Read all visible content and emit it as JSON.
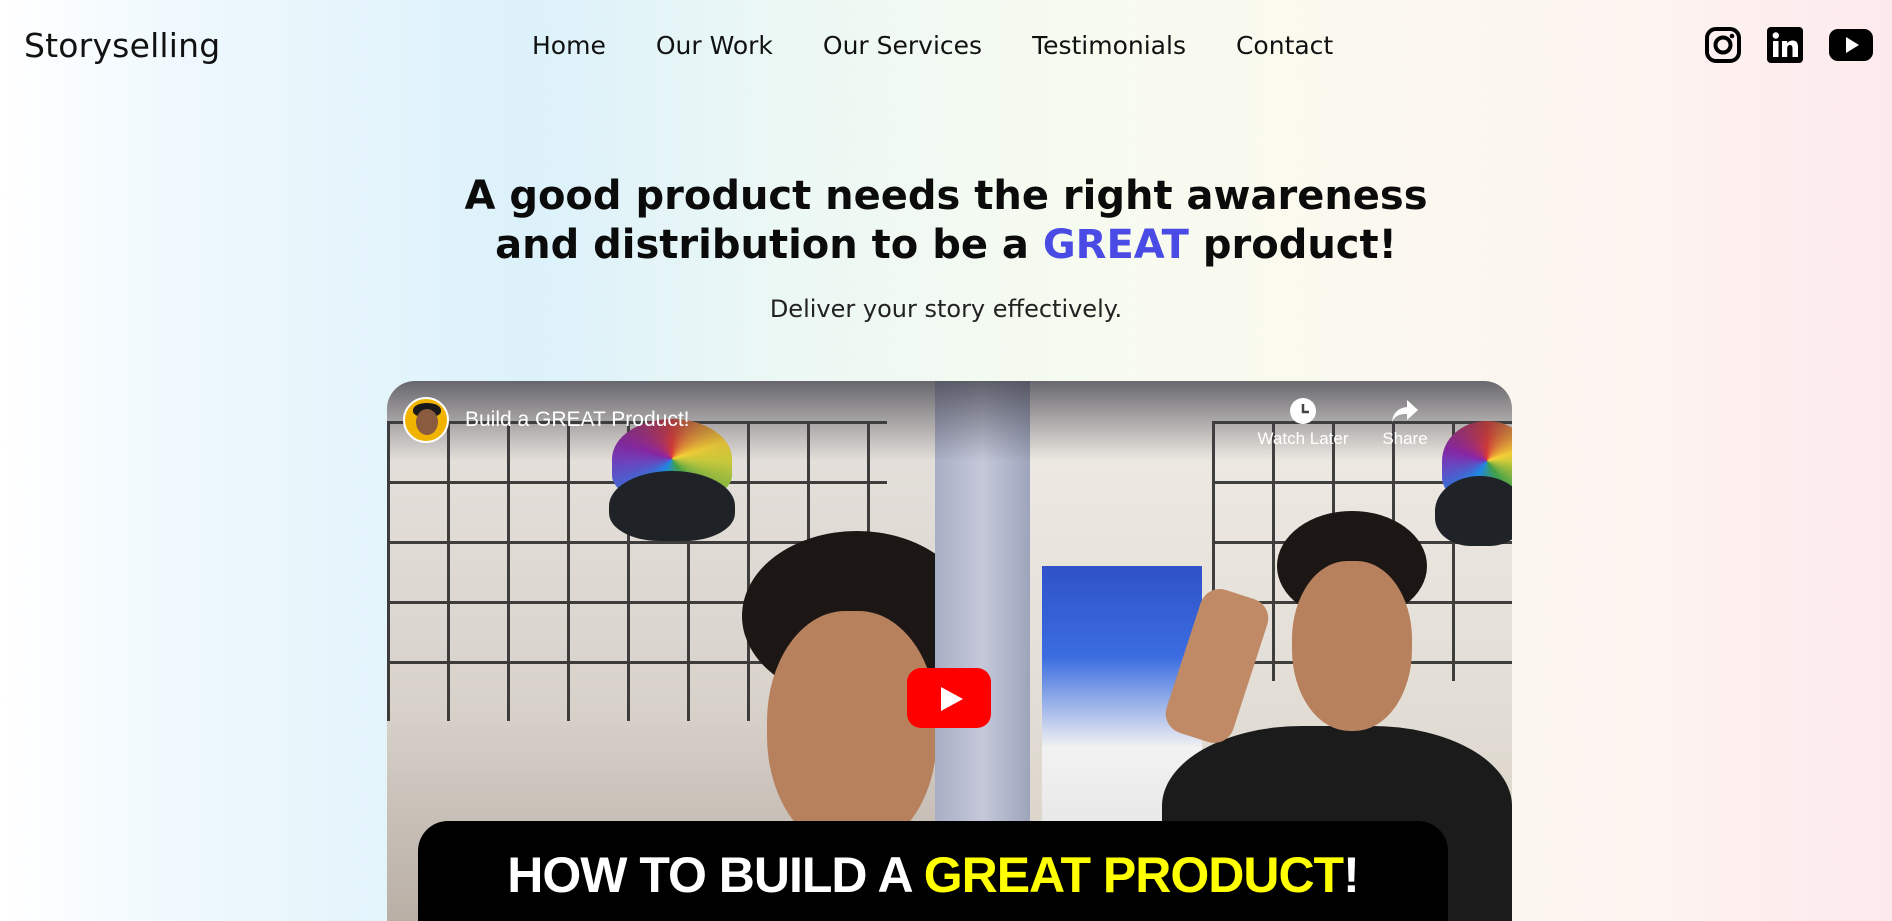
{
  "brand": {
    "name": "Storyselling"
  },
  "nav": {
    "items": [
      {
        "label": "Home"
      },
      {
        "label": "Our Work"
      },
      {
        "label": "Our Services"
      },
      {
        "label": "Testimonials"
      },
      {
        "label": "Contact"
      }
    ]
  },
  "social": {
    "icons": [
      "instagram-icon",
      "linkedin-icon",
      "youtube-icon"
    ]
  },
  "hero": {
    "headline_line1": "A good product needs the right awareness",
    "headline_line2_before": "and distribution to be a",
    "headline_accent": "GREAT",
    "headline_line2_after": "product!",
    "subtitle": "Deliver your story effectively.",
    "accent_color": "#4a4ae4"
  },
  "video": {
    "title": "Build a GREAT Product!",
    "watch_later_label": "Watch Later",
    "share_label": "Share",
    "banner_white": "HOW TO BUILD A",
    "banner_yellow": "GREAT PRODUCT",
    "banner_end": "!",
    "play_color": "#ff0000"
  }
}
